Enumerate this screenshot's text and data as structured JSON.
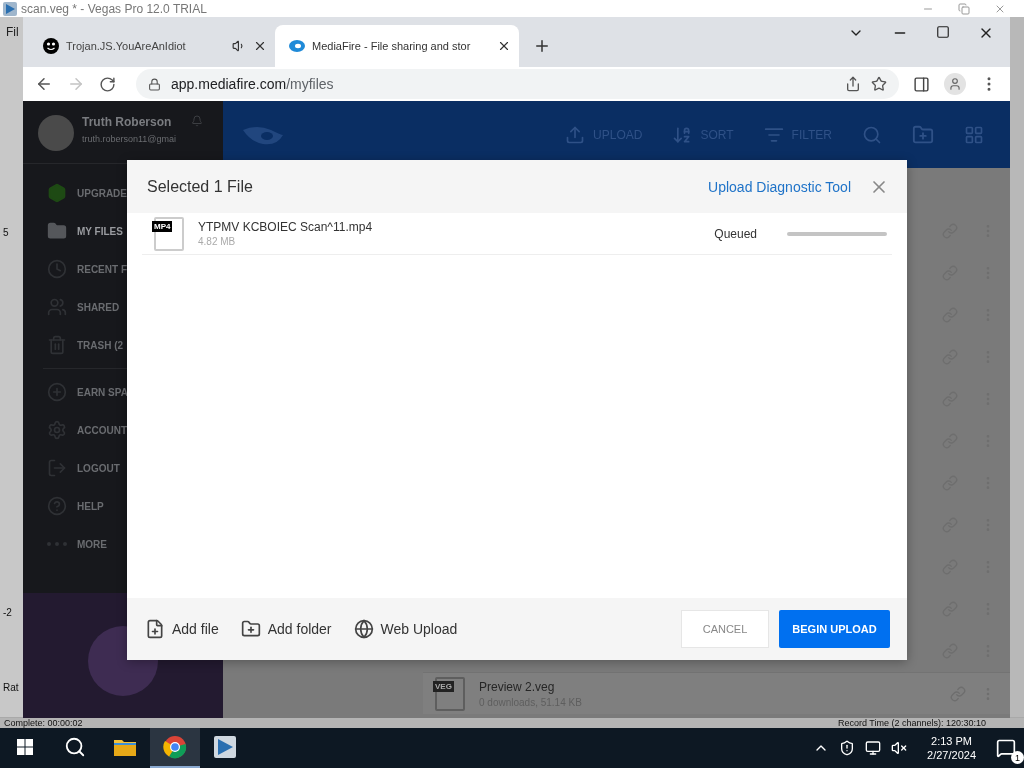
{
  "desktop_window": {
    "title": "scan.veg * - Vegas Pro 12.0 TRIAL",
    "menu_label": "Fil",
    "side_texts": [
      "5",
      "-2",
      "Rat"
    ],
    "status_left": "Complete: 00:00:02",
    "status_right": "Record Time (2 channels): 120:30:10"
  },
  "browser": {
    "tabs": [
      {
        "title": "Trojan.JS.YouAreAnIdiot",
        "selected": false,
        "kind": "smiley",
        "audio": true
      },
      {
        "title": "MediaFire - File sharing and stor",
        "selected": true,
        "kind": "mediafire",
        "audio": false
      }
    ],
    "url_host": "app.mediafire.com",
    "url_path": "/myfiles",
    "forward_enabled": false
  },
  "sidebar": {
    "user_name": "Truth Roberson",
    "user_email": "truth.roberson11@gmai",
    "items": [
      {
        "label": "UPGRADE",
        "kind": "upgrade",
        "selected": false
      },
      {
        "label": "MY FILES",
        "kind": "files",
        "selected": true
      },
      {
        "label": "RECENT F",
        "kind": "recent",
        "selected": false
      },
      {
        "label": "SHARED",
        "kind": "shared",
        "selected": false
      },
      {
        "label": "TRASH (2",
        "kind": "trash",
        "selected": false
      },
      {
        "label": "EARN SPA",
        "kind": "earn",
        "selected": false
      },
      {
        "label": "ACCOUNT",
        "kind": "account",
        "selected": false
      },
      {
        "label": "LOGOUT",
        "kind": "logout",
        "selected": false
      },
      {
        "label": "HELP",
        "kind": "help",
        "selected": false
      },
      {
        "label": "MORE",
        "kind": "more",
        "selected": false
      }
    ]
  },
  "toolbar": {
    "actions": [
      {
        "label": "UPLOAD",
        "kind": "upload"
      },
      {
        "label": "SORT",
        "kind": "sort"
      },
      {
        "label": "FILTER",
        "kind": "filter"
      }
    ]
  },
  "files": [
    {
      "badge": "VEG",
      "name": "Preview 2.veg",
      "meta": "0 downloads, 51.14 KB"
    }
  ],
  "upload_dialog": {
    "title": "Selected 1 File",
    "link": "Upload Diagnostic Tool",
    "files": [
      {
        "badge": "MP4",
        "name": "YTPMV KCBOIEC Scan^11.mp4",
        "size": "4.82 MB",
        "status": "Queued",
        "level": 0
      }
    ],
    "footer_actions": [
      {
        "label": "Add file",
        "kind": "file"
      },
      {
        "label": "Add folder",
        "kind": "folder"
      },
      {
        "label": "Web Upload",
        "kind": "web"
      }
    ],
    "cancel": "CANCEL",
    "submit": "BEGIN UPLOAD"
  },
  "taskbar": {
    "apps": [
      {
        "kind": "explorer",
        "selected": false
      },
      {
        "kind": "chrome",
        "selected": true
      },
      {
        "kind": "vegas",
        "selected": false
      }
    ],
    "time": "2:13 PM",
    "date": "2/27/2024",
    "notification_count": "1"
  }
}
